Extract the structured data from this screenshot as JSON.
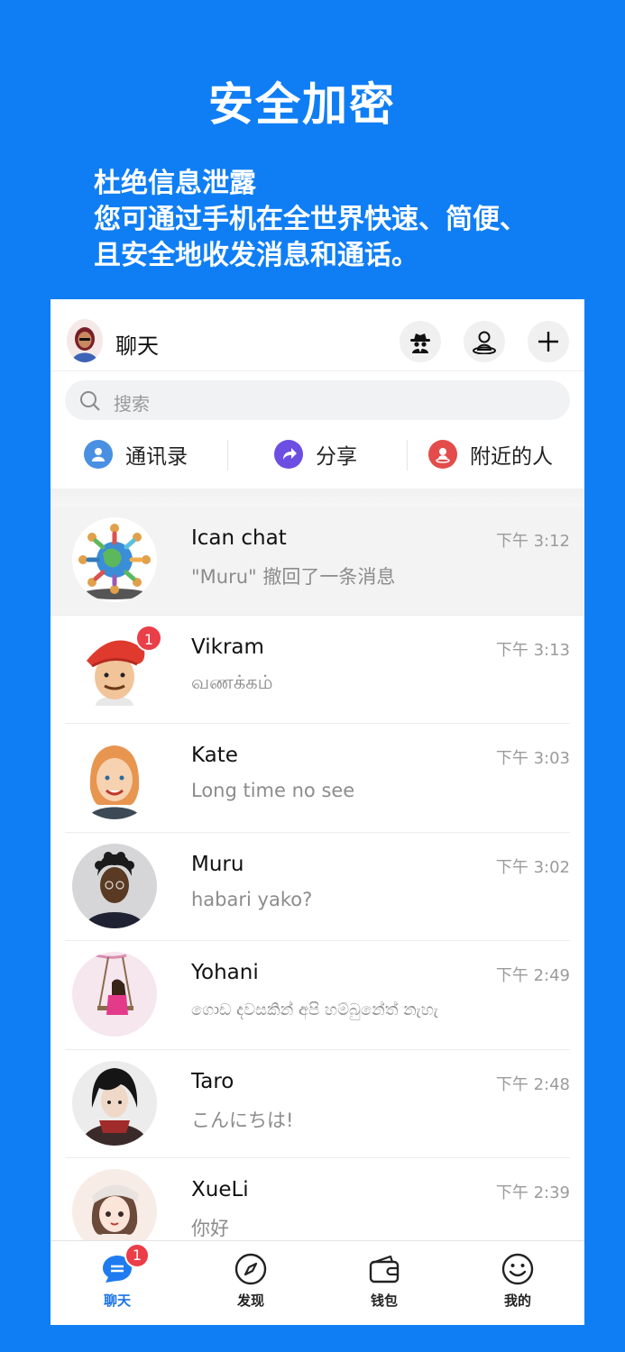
{
  "promo": {
    "title": "安全加密",
    "lines": [
      "杜绝信息泄露",
      "您可通过手机在全世界快速、简便、",
      "且安全地收发消息和通话。"
    ]
  },
  "topbar": {
    "title": "聊天"
  },
  "search": {
    "placeholder": "搜索"
  },
  "shortcuts": [
    {
      "label": "通讯录",
      "icon": "contacts-icon",
      "color": "#4a90e2"
    },
    {
      "label": "分享",
      "icon": "share-icon",
      "color": "#6c4ee3"
    },
    {
      "label": "附近的人",
      "icon": "nearby-icon",
      "color": "#e44b4b"
    }
  ],
  "chats": [
    {
      "name": "Ican chat",
      "message": "\"Muru\" 撤回了一条消息",
      "time": "下午 3:12"
    },
    {
      "name": "Vikram",
      "message": "வணக்கம்",
      "time": "下午 3:13",
      "badge": "1"
    },
    {
      "name": "Kate",
      "message": "Long time no see",
      "time": "下午 3:03"
    },
    {
      "name": "Muru",
      "message": "habari yako?",
      "time": "下午 3:02"
    },
    {
      "name": "Yohani",
      "message": "ගොඩ දවසකින් අපි හම්බුනේත් නැහැ",
      "time": "下午 2:49"
    },
    {
      "name": "Taro",
      "message": "こんにちは!",
      "time": "下午 2:48"
    },
    {
      "name": "XueLi",
      "message": "你好",
      "time": "下午 2:39"
    }
  ],
  "tabs": [
    {
      "label": "聊天",
      "badge": "1",
      "active": true
    },
    {
      "label": "发现"
    },
    {
      "label": "钱包"
    },
    {
      "label": "我的"
    }
  ],
  "colors": {
    "brand_blue": "#0f7ef5",
    "badge_red": "#ea3e48",
    "active_tab": "#1a73e8"
  }
}
